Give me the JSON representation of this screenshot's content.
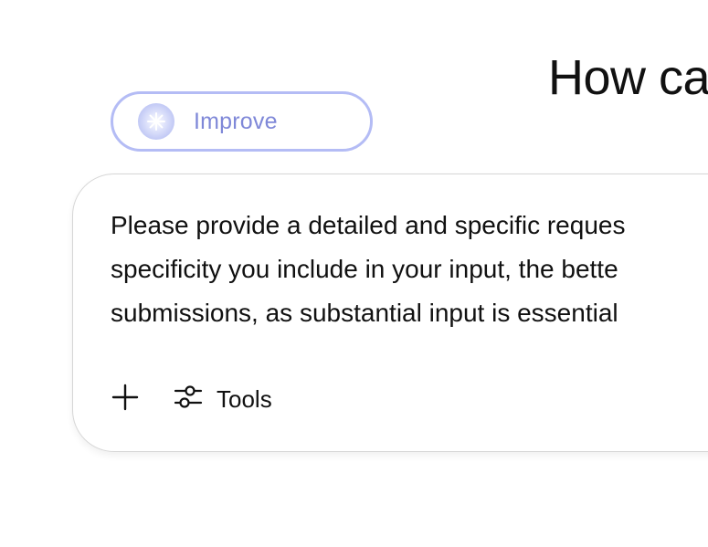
{
  "main": {
    "heading": "How ca"
  },
  "improve": {
    "label": "Improve",
    "icon": "sparkle-icon",
    "accent": "#b4bcf5",
    "label_color": "#7f88d8"
  },
  "composer": {
    "lines": [
      "Please provide a detailed and specific reques",
      "specificity you include in your input, the bette",
      "submissions, as substantial input is essential"
    ],
    "toolbar": {
      "add_icon": "plus-icon",
      "tools_icon": "sliders-icon",
      "tools_label": "Tools"
    }
  }
}
